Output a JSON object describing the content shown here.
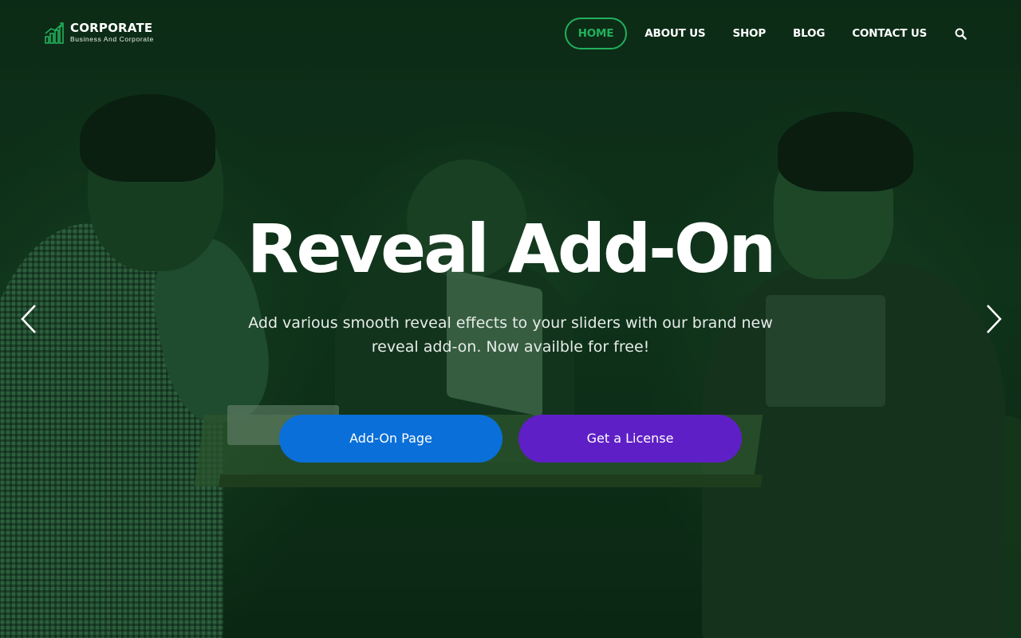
{
  "brand": {
    "title": "CORPORATE",
    "tagline": "Business And Corporate",
    "accent_color": "#22b05c"
  },
  "nav": {
    "items": [
      {
        "label": "HOME",
        "active": true
      },
      {
        "label": "ABOUT US",
        "active": false
      },
      {
        "label": "SHOP",
        "active": false
      },
      {
        "label": "BLOG",
        "active": false
      },
      {
        "label": "CONTACT US",
        "active": false
      }
    ],
    "search_icon": "search-icon"
  },
  "hero": {
    "headline": "Reveal Add-On",
    "subtitle": "Add various smooth reveal effects to your sliders with our brand new reveal add-on. Now availble for free!",
    "buttons": {
      "primary_label": "Add-On Page",
      "primary_color": "#0a6fd8",
      "secondary_label": "Get a License",
      "secondary_color": "#5f1fc6"
    },
    "prev_icon": "chevron-left-icon",
    "next_icon": "chevron-right-icon"
  }
}
